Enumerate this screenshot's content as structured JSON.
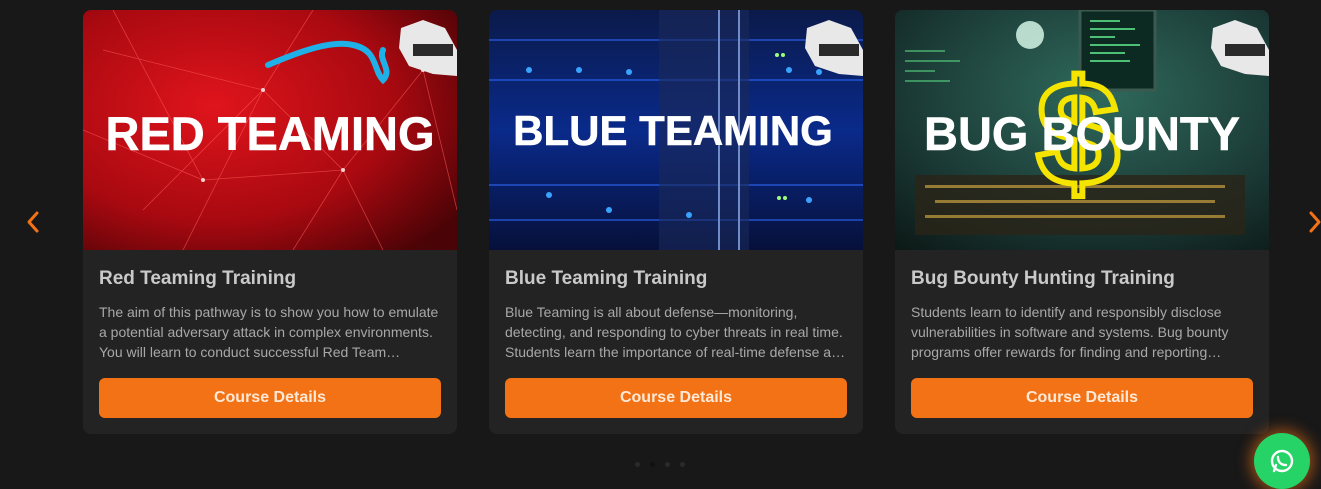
{
  "cards": [
    {
      "banner_text": "RED TEAMING",
      "title": "Red Teaming Training",
      "desc_lines": [
        "The aim of this pathway is to show you how to emulate",
        "a potential adversary attack in complex environments.",
        "You will learn to conduct successful Red Team…"
      ],
      "button_label": "Course Details"
    },
    {
      "banner_text": "BLUE TEAMING",
      "title": "Blue Teaming Training",
      "desc_lines": [
        "Blue Teaming is all about defense—monitoring,",
        "detecting, and responding to cyber threats in real time.",
        "Students learn the importance of real-time defense a…"
      ],
      "button_label": "Course Details"
    },
    {
      "banner_text": "BUG BOUNTY",
      "title": "Bug Bounty Hunting Training",
      "desc_lines": [
        "Students learn to identify and responsibly disclose",
        "vulnerabilities in software and systems. Bug bounty",
        "programs offer rewards for finding and reporting…"
      ],
      "button_label": "Course Details"
    }
  ],
  "colors": {
    "accent": "#f47216",
    "background": "#181818",
    "card": "#232323",
    "whatsapp": "#25d366"
  },
  "icons": {
    "prev": "chevron-left-icon",
    "next": "chevron-right-icon",
    "chat": "whatsapp-icon"
  }
}
